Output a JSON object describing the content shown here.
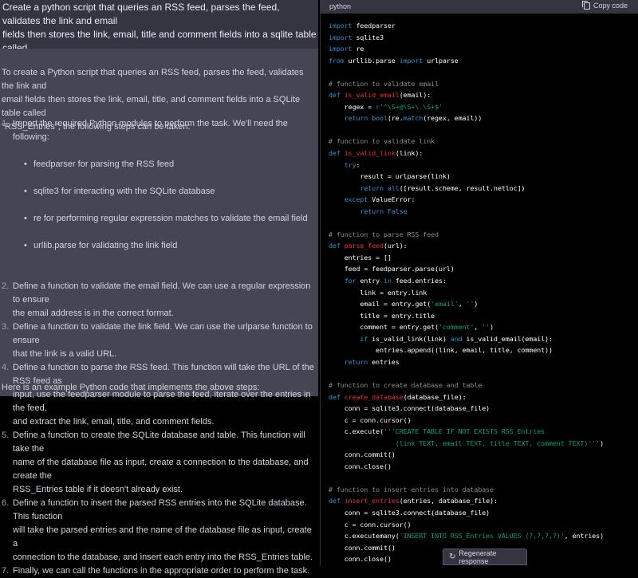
{
  "user_message": "Create a python script that queries an RSS feed, parses the feed, validates the link and email\nfields then stores the link, email, title and comment fields into a sqlite table called\nRSS_Entries. Plan out the solution prior to generating code.",
  "assistant": {
    "intro": "To create a Python script that queries an RSS feed, parses the feed, validates the link and\nemail fields then stores the link, email, title, and comment fields into a SQLite table called\n\"RSS_Entries\", the following steps can be taken:",
    "steps": [
      {
        "num": "1.",
        "text": "Import the required Python modules to perform the task. We'll need the following:"
      },
      {
        "num": "2.",
        "text": "Define a function to validate the email field. We can use a regular expression to ensure\nthe email address is in the correct format."
      },
      {
        "num": "3.",
        "text": "Define a function to validate the link field. We can use the urlparse function to ensure\nthat the link is a valid URL."
      },
      {
        "num": "4.",
        "text": "Define a function to parse the RSS feed. This function will take the URL of the RSS feed as\ninput, use the feedparser module to parse the feed, iterate over the entries in the feed,\nand extract the link, email, title, and comment fields."
      },
      {
        "num": "5.",
        "text": "Define a function to create the SQLite database and table. This function will take the\nname of the database file as input, create a connection to the database, and create the\nRSS_Entries table if it doesn't already exist."
      },
      {
        "num": "6.",
        "text": "Define a function to insert the parsed RSS entries into the SQLite database. This function\nwill take the parsed entries and the name of the database file as input, create a\nconnection to the database, and insert each entry into the RSS_Entries table."
      },
      {
        "num": "7.",
        "text": "Finally, we can call the functions in the appropriate order to perform the task."
      }
    ],
    "modules": [
      "feedparser for parsing the RSS feed",
      "sqlite3 for interacting with the SQLite database",
      "re for performing regular expression matches to validate the email field",
      "urllib.parse for validating the link field"
    ],
    "outro": "Here is an example Python code that implements the above steps:"
  },
  "code_block": {
    "language": "python",
    "copy_label": "Copy code",
    "copy_icon": "clipboard-icon",
    "lines": [
      [
        [
          "kw",
          "import"
        ],
        [
          "t",
          " feedparser"
        ]
      ],
      [
        [
          "kw",
          "import"
        ],
        [
          "t",
          " sqlite3"
        ]
      ],
      [
        [
          "kw",
          "import"
        ],
        [
          "t",
          " re"
        ]
      ],
      [
        [
          "kw",
          "from"
        ],
        [
          "t",
          " urllib.parse "
        ],
        [
          "kw",
          "import"
        ],
        [
          "t",
          " urlparse"
        ]
      ],
      [],
      [
        [
          "cm",
          "# function to validate email"
        ]
      ],
      [
        [
          "kw",
          "def"
        ],
        [
          "t",
          " "
        ],
        [
          "fn",
          "is_valid_email"
        ],
        [
          "t",
          "(email):"
        ]
      ],
      [
        [
          "t",
          "    regex = "
        ],
        [
          "str",
          "r'^\\S+@\\S+\\.\\S+$'"
        ]
      ],
      [
        [
          "t",
          "    "
        ],
        [
          "kw",
          "return"
        ],
        [
          "t",
          " "
        ],
        [
          "kw",
          "bool"
        ],
        [
          "t",
          "(re."
        ],
        [
          "kw",
          "match"
        ],
        [
          "t",
          "(regex, email))"
        ]
      ],
      [],
      [
        [
          "cm",
          "# function to validate link"
        ]
      ],
      [
        [
          "kw",
          "def"
        ],
        [
          "t",
          " "
        ],
        [
          "fn",
          "is_valid_link"
        ],
        [
          "t",
          "(link):"
        ]
      ],
      [
        [
          "t",
          "    "
        ],
        [
          "kw",
          "try"
        ],
        [
          "t",
          ":"
        ]
      ],
      [
        [
          "t",
          "        result = urlparse(link)"
        ]
      ],
      [
        [
          "t",
          "        "
        ],
        [
          "kw",
          "return"
        ],
        [
          "t",
          " "
        ],
        [
          "kw",
          "all"
        ],
        [
          "t",
          "([result.scheme, result.netloc])"
        ]
      ],
      [
        [
          "t",
          "    "
        ],
        [
          "kw",
          "except"
        ],
        [
          "t",
          " ValueError:"
        ]
      ],
      [
        [
          "t",
          "        "
        ],
        [
          "kw",
          "return"
        ],
        [
          "t",
          " "
        ],
        [
          "kw",
          "False"
        ]
      ],
      [],
      [
        [
          "cm",
          "# function to parse RSS feed"
        ]
      ],
      [
        [
          "kw",
          "def"
        ],
        [
          "t",
          " "
        ],
        [
          "fn",
          "parse_feed"
        ],
        [
          "t",
          "(url):"
        ]
      ],
      [
        [
          "t",
          "    entries = []"
        ]
      ],
      [
        [
          "t",
          "    feed = feedparser.parse(url)"
        ]
      ],
      [
        [
          "t",
          "    "
        ],
        [
          "kw",
          "for"
        ],
        [
          "t",
          " entry "
        ],
        [
          "kw",
          "in"
        ],
        [
          "t",
          " feed.entries:"
        ]
      ],
      [
        [
          "t",
          "        link = entry.link"
        ]
      ],
      [
        [
          "t",
          "        email = entry.get("
        ],
        [
          "str",
          "'email'"
        ],
        [
          "t",
          ", "
        ],
        [
          "str",
          "''"
        ],
        [
          "t",
          ")"
        ]
      ],
      [
        [
          "t",
          "        title = entry.title"
        ]
      ],
      [
        [
          "t",
          "        comment = entry.get("
        ],
        [
          "str",
          "'comment'"
        ],
        [
          "t",
          ", "
        ],
        [
          "str",
          "''"
        ],
        [
          "t",
          ")"
        ]
      ],
      [
        [
          "t",
          "        "
        ],
        [
          "kw",
          "if"
        ],
        [
          "t",
          " is_valid_link(link) "
        ],
        [
          "kw",
          "and"
        ],
        [
          "t",
          " is_valid_email(email):"
        ]
      ],
      [
        [
          "t",
          "            entries.append((link, email, title, comment))"
        ]
      ],
      [
        [
          "t",
          "    "
        ],
        [
          "kw",
          "return"
        ],
        [
          "t",
          " entries"
        ]
      ],
      [],
      [
        [
          "cm",
          "# function to create database and table"
        ]
      ],
      [
        [
          "kw",
          "def"
        ],
        [
          "t",
          " "
        ],
        [
          "fn",
          "create_database"
        ],
        [
          "t",
          "(database_file):"
        ]
      ],
      [
        [
          "t",
          "    conn = sqlite3.connect(database_file)"
        ]
      ],
      [
        [
          "t",
          "    c = conn.cursor()"
        ]
      ],
      [
        [
          "t",
          "    c.execute("
        ],
        [
          "str",
          "'''CREATE TABLE IF NOT EXISTS RSS_Entries"
        ]
      ],
      [
        [
          "str",
          "                 (link TEXT, email TEXT, title TEXT, comment TEXT)'''"
        ],
        [
          "t",
          ")"
        ]
      ],
      [
        [
          "t",
          "    conn.commit()"
        ]
      ],
      [
        [
          "t",
          "    conn.close()"
        ]
      ],
      [],
      [
        [
          "cm",
          "# function to insert entries into database"
        ]
      ],
      [
        [
          "kw",
          "def"
        ],
        [
          "t",
          " "
        ],
        [
          "fn",
          "insert_entries"
        ],
        [
          "t",
          "(entries, database_file):"
        ]
      ],
      [
        [
          "t",
          "    conn = sqlite3.connect(database_file)"
        ]
      ],
      [
        [
          "t",
          "    c = conn.cursor()"
        ]
      ],
      [
        [
          "t",
          "    c.executemany("
        ],
        [
          "str",
          "'INSERT INTO RSS_Entries VALUES (?,?,?,?)'"
        ],
        [
          "t",
          ", entries)"
        ]
      ],
      [
        [
          "t",
          "    conn.commit()"
        ]
      ],
      [
        [
          "t",
          "    conn.close()"
        ]
      ]
    ]
  },
  "regenerate_label": "Regenerate response",
  "colors": {
    "keyword": "#2e95d3",
    "function": "#f22c3d",
    "string": "#00a67d",
    "comment": "#8e8e8e"
  }
}
